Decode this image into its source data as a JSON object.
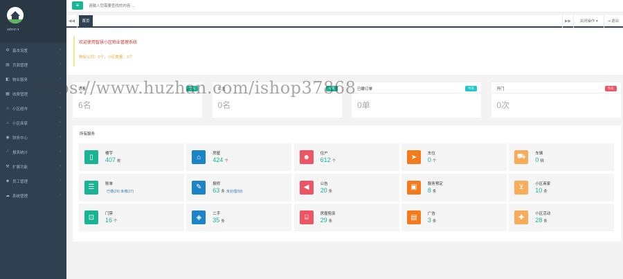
{
  "sidebar": {
    "user_name": "admin ▾",
    "items": [
      {
        "label": "基本设置",
        "icon": "gear-icon",
        "glyph": "⚙"
      },
      {
        "label": "页面管理",
        "icon": "file-icon",
        "glyph": "▤"
      },
      {
        "label": "物业服务",
        "icon": "service-icon",
        "glyph": "◧"
      },
      {
        "label": "收费管理",
        "icon": "money-icon",
        "glyph": "▦"
      },
      {
        "label": "小区超市",
        "icon": "cart-icon",
        "glyph": "⌂"
      },
      {
        "label": "小区商家",
        "icon": "shop-icon",
        "glyph": "⌂"
      },
      {
        "label": "财务中心",
        "icon": "finance-icon",
        "glyph": "◉"
      },
      {
        "label": "报表统计",
        "icon": "chart-icon",
        "glyph": "⟋"
      },
      {
        "label": "扩展功能",
        "icon": "plug-icon",
        "glyph": "⚒"
      },
      {
        "label": "员工管理",
        "icon": "users-icon",
        "glyph": "☻"
      },
      {
        "label": "系统管理",
        "icon": "cloud-icon",
        "glyph": "☁"
      }
    ]
  },
  "topbar": {
    "menu_glyph": "≡",
    "search_placeholder": "请输入您需要查找的内容 ..."
  },
  "tabs": {
    "left_arrow": "◀◀",
    "home": "首页",
    "right_arrow": "▶▶",
    "close_label": "关闭操作 ▾",
    "exit_label": "⇥ 退出"
  },
  "welcome": {
    "title": "欢迎使用智慧小区物业管理系统",
    "stats": "物业公司：0个，小区数量：3个"
  },
  "stat_cards": [
    {
      "title": "访客",
      "badge": "今天",
      "badge_color": "#1ab394",
      "value": "6名"
    },
    {
      "title": "业主",
      "badge": "今天",
      "badge_color": "#1ab394",
      "value": "0名"
    },
    {
      "title": "已缴订单",
      "badge": "今天",
      "badge_color": "#23c6c8",
      "value": "0单"
    },
    {
      "title": "开门",
      "badge": "今天",
      "badge_color": "#ed5565",
      "value": "0次"
    }
  ],
  "services": {
    "title": "所有服务",
    "cells": [
      {
        "name": "楼宇",
        "value": "407",
        "unit": "栋",
        "sub": "",
        "color": "#1ab394",
        "icon": "building-icon",
        "glyph": "▯"
      },
      {
        "name": "房屋",
        "value": "424",
        "unit": "个",
        "sub": "",
        "color": "#1c84c6",
        "icon": "home-icon",
        "glyph": "⌂"
      },
      {
        "name": "住户",
        "value": "612",
        "unit": "个",
        "sub": "",
        "color": "#ed5565",
        "icon": "person-icon",
        "glyph": "☻"
      },
      {
        "name": "车位",
        "value": "0",
        "unit": "个",
        "sub": "",
        "color": "#f37b1d",
        "icon": "send-icon",
        "glyph": "➤"
      },
      {
        "name": "车辆",
        "value": "0",
        "unit": "辆",
        "sub": "",
        "color": "#f8ac59",
        "icon": "car-icon",
        "glyph": "⛟"
      },
      {
        "name": "账单",
        "value": "",
        "unit": "",
        "sub": "已缴(29) 未缴(27)",
        "color": "#1ab394",
        "icon": "list-icon",
        "glyph": "☰"
      },
      {
        "name": "报修",
        "value": "63",
        "unit": "条",
        "sub": "未处理(58)",
        "color": "#1c84c6",
        "icon": "wrench-icon",
        "glyph": "✎"
      },
      {
        "name": "公告",
        "value": "20",
        "unit": "条",
        "sub": "",
        "color": "#ed5565",
        "icon": "bullhorn-icon",
        "glyph": "◀"
      },
      {
        "name": "服务预定",
        "value": "8",
        "unit": "条",
        "sub": "",
        "color": "#f37b1d",
        "icon": "calendar-icon",
        "glyph": "▣"
      },
      {
        "name": "小区商家",
        "value": "10",
        "unit": "条",
        "sub": "",
        "color": "#f8ac59",
        "icon": "cart-icon",
        "glyph": "⊻"
      },
      {
        "name": "门禁",
        "value": "16",
        "unit": "个",
        "sub": "",
        "color": "#1ab394",
        "icon": "lock-icon",
        "glyph": "⊡"
      },
      {
        "name": "二手",
        "value": "35",
        "unit": "条",
        "sub": "",
        "color": "#1c84c6",
        "icon": "cube-icon",
        "glyph": "◈"
      },
      {
        "name": "房屋租赁",
        "value": "29",
        "unit": "条",
        "sub": "",
        "color": "#ed5565",
        "icon": "bank-icon",
        "glyph": "⌸"
      },
      {
        "name": "广告",
        "value": "3",
        "unit": "条",
        "sub": "",
        "color": "#f37b1d",
        "icon": "newspaper-icon",
        "glyph": "▤"
      },
      {
        "name": "小区活动",
        "value": "28",
        "unit": "条",
        "sub": "",
        "color": "#f8ac59",
        "icon": "gift-icon",
        "glyph": "✚"
      }
    ]
  },
  "watermark": "https://www.huzhan.com/ishop37868"
}
